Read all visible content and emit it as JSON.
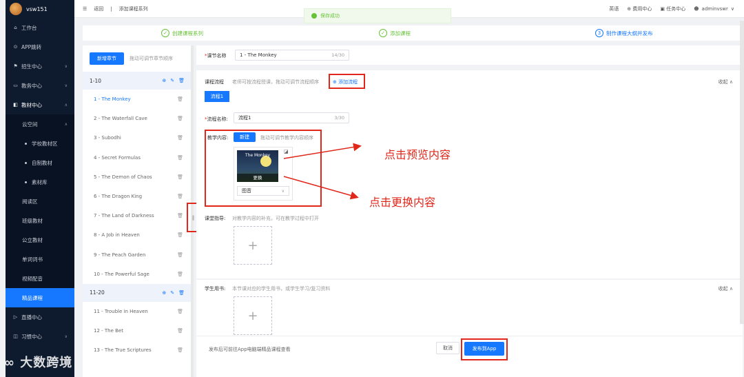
{
  "app": {
    "username": "vsw151"
  },
  "sidebar": {
    "items": [
      {
        "icon": "home-icon",
        "label": "工作台"
      },
      {
        "icon": "app-icon",
        "label": "APP跳转"
      },
      {
        "icon": "flag-icon",
        "label": "招生中心"
      },
      {
        "icon": "book-icon",
        "label": "教务中心"
      },
      {
        "icon": "material-icon",
        "label": "教材中心"
      }
    ],
    "cloud": "云空间",
    "cloud_sub": [
      "学校教材区",
      "自制教材",
      "素材库"
    ],
    "more": [
      "阅读区",
      "班级教材",
      "公立教材",
      "单词词书",
      "视频配音",
      "精品课程"
    ],
    "live": "直播中心",
    "study": "习惯中心"
  },
  "topbar": {
    "back": "返回",
    "breadcrumb": "添加课程系列",
    "lang": "英语",
    "fee": "费用中心",
    "task": "任务中心",
    "user": "adminvswr"
  },
  "toast": "保存成功",
  "steps": [
    {
      "num": "✓",
      "label": "创建课程系列"
    },
    {
      "num": "✓",
      "label": "添加课程"
    },
    {
      "num": "3",
      "label": "制作课程大纲并发布"
    }
  ],
  "chapters": {
    "add_btn": "新增章节",
    "drag_hint": "拖动可调节章节顺序",
    "group1": "1-10",
    "group2": "11-20",
    "lessons1": [
      "1 - The Monkey",
      "2 - The Waterfall Cave",
      "3 - Subodhi",
      "4 - Secret Formulas",
      "5 - The Demon of Chaos",
      "6 - The Dragon King",
      "7 - The Land of Darkness",
      "8 - A Job in Heaven",
      "9 - The Peach Garden",
      "10 - The Powerful Sage"
    ],
    "lessons2": [
      "11 - Trouble in Heaven",
      "12 - The Bet",
      "13 - The True Scriptures"
    ]
  },
  "lesson_form": {
    "name_label": "课节名称",
    "name_value": "1 - The Monkey",
    "name_count": "14/30",
    "flow_label": "课程流程",
    "flow_hint": "老师可按流程授课，拖动可调节流程顺序",
    "add_flow": "添加流程",
    "collapse": "收起",
    "flow_tab": "流程1",
    "flow_name_label": "流程名称:",
    "flow_name_value": "流程1",
    "flow_name_count": "3/30",
    "teach_label": "教学内容:",
    "new_btn": "新建",
    "teach_hint": "拖动可调节教学内容顺序",
    "thumb_title": "The Monkey",
    "replace": "更换",
    "type_select": "图音",
    "guide_label": "课堂指导:",
    "guide_hint": "对教学内容的补充，可在教学过程中打开",
    "student_label": "学生用书:",
    "student_hint": "本节课对应的学生用书，或学生学习/复习资料",
    "student_collapse": "收起"
  },
  "annotations": {
    "preview": "点击预览内容",
    "replace": "点击更换内容"
  },
  "footer": {
    "hint": "发布后可前往App电脑端精品课程查看",
    "cancel": "取消",
    "publish": "发布到App"
  },
  "watermark": "大数跨境",
  "colors": {
    "primary": "#1677ff",
    "annotation": "#e0271a",
    "success": "#67c23a",
    "sidebar": "#0e1a2e"
  }
}
